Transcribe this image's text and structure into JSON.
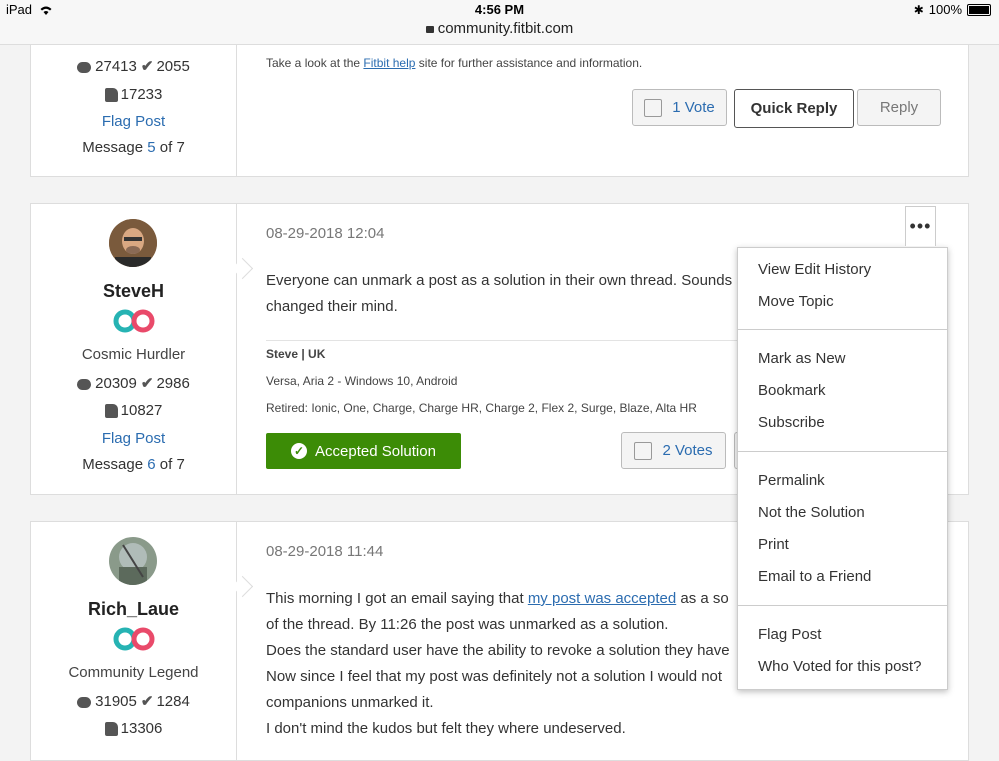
{
  "status_bar": {
    "device": "iPad",
    "time": "4:56 PM",
    "battery": "100%",
    "url": "community.fitbit.com"
  },
  "post1": {
    "stats": {
      "messages": "27413",
      "solutions": "2055",
      "kudos": "17233"
    },
    "flag_label": "Flag Post",
    "message_prefix": "Message",
    "message_num": "5",
    "message_suffix": "of 7",
    "help_text_before": "Take a look at the",
    "help_link": "Fitbit help",
    "help_text_after": "site for further assistance and information.",
    "vote_label": "1 Vote",
    "quick_reply_label": "Quick Reply",
    "reply_label": "Reply"
  },
  "post2": {
    "username": "SteveH",
    "rank": "Cosmic Hurdler",
    "stats": {
      "messages": "20309",
      "solutions": "2986",
      "kudos": "10827"
    },
    "flag_label": "Flag Post",
    "message_prefix": "Message",
    "message_num": "6",
    "message_suffix": "of 7",
    "date": "08-29-2018 12:04",
    "body_line1": "Everyone can unmark a post as a solution in their own thread. Sounds",
    "body_line2": "changed their mind.",
    "sig_name": "Steve | UK",
    "sig_line1": "Versa, Aria 2 - Windows 10, Android",
    "sig_line2": "Retired: Ionic, One, Charge, Charge HR, Charge 2, Flex 2, Surge, Blaze, Alta HR",
    "accepted_label": "Accepted Solution",
    "vote_label": "2 Votes"
  },
  "post3": {
    "username": "Rich_Laue",
    "rank": "Community Legend",
    "stats": {
      "messages": "31905",
      "solutions": "1284",
      "kudos": "13306"
    },
    "date": "08-29-2018 11:44",
    "line1_before": "This morning I got an email saying that",
    "line1_link": "my post was accepted",
    "line1_after": "as a so",
    "line2": "of the thread. By 11:26 the post was unmarked as a solution.",
    "line3": "Does the standard user have the ability to revoke a solution they have",
    "line4": "Now since I feel that my post was definitely not a solution  I would not",
    "line5": "companions unmarked it.",
    "line6": "I don't mind the kudos but felt they where undeserved."
  },
  "menu": {
    "dots": "•••",
    "items": [
      "View Edit History",
      "Move Topic",
      "Mark as New",
      "Bookmark",
      "Subscribe",
      "Permalink",
      "Not the Solution",
      "Print",
      "Email to a Friend",
      "Flag Post",
      "Who Voted for this post?"
    ]
  },
  "colors": {
    "link": "#2b6cb0",
    "accepted": "#3c8c06",
    "rank_teal": "#26b3b3",
    "rank_pink": "#e94a6a"
  }
}
